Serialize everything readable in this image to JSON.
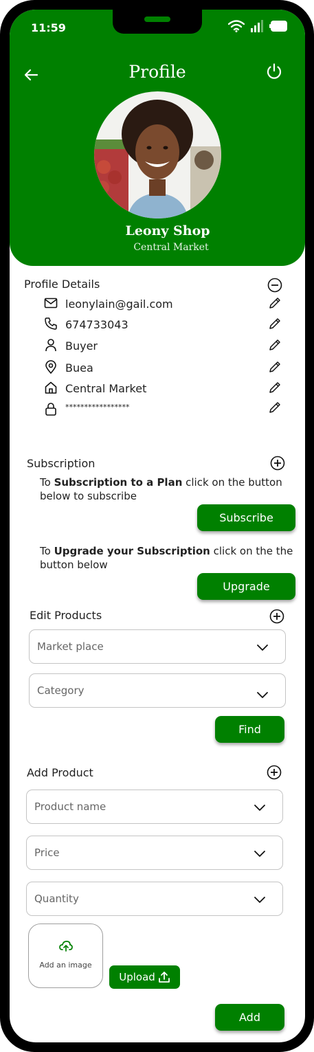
{
  "status_bar": {
    "time": "11:59"
  },
  "header": {
    "title": "Profile",
    "shop_name": "Leony Shop",
    "shop_location": "Central Market"
  },
  "profile_details": {
    "title": "Profile Details",
    "items": [
      {
        "icon": "mail-icon",
        "value": "leonylain@gail.com"
      },
      {
        "icon": "phone-icon",
        "value": "674733043"
      },
      {
        "icon": "user-icon",
        "value": "Buyer"
      },
      {
        "icon": "location-pin-icon",
        "value": "Buea"
      },
      {
        "icon": "home-icon",
        "value": "Central Market"
      },
      {
        "icon": "lock-icon",
        "value": "*****************"
      }
    ]
  },
  "subscription": {
    "title": "Subscription",
    "subscribe_text_pre": "To ",
    "subscribe_text_bold": "Subscription to a Plan",
    "subscribe_text_post": " click on the button below to subscribe",
    "subscribe_button": "Subscribe",
    "upgrade_text_pre": "To ",
    "upgrade_text_bold": "Upgrade your Subscription",
    "upgrade_text_post": " click on the the button below",
    "upgrade_button": "Upgrade"
  },
  "edit_products": {
    "title": "Edit Products",
    "market_place_placeholder": "Market place",
    "category_placeholder": "Category",
    "find_button": "Find"
  },
  "add_product": {
    "title": "Add Product",
    "product_name_placeholder": "Product name",
    "price_placeholder": "Price",
    "quantity_placeholder": "Quantity",
    "add_image_label": "Add an image",
    "upload_button": "Upload",
    "add_button": "Add"
  },
  "colors": {
    "brand_green": "#008000"
  }
}
